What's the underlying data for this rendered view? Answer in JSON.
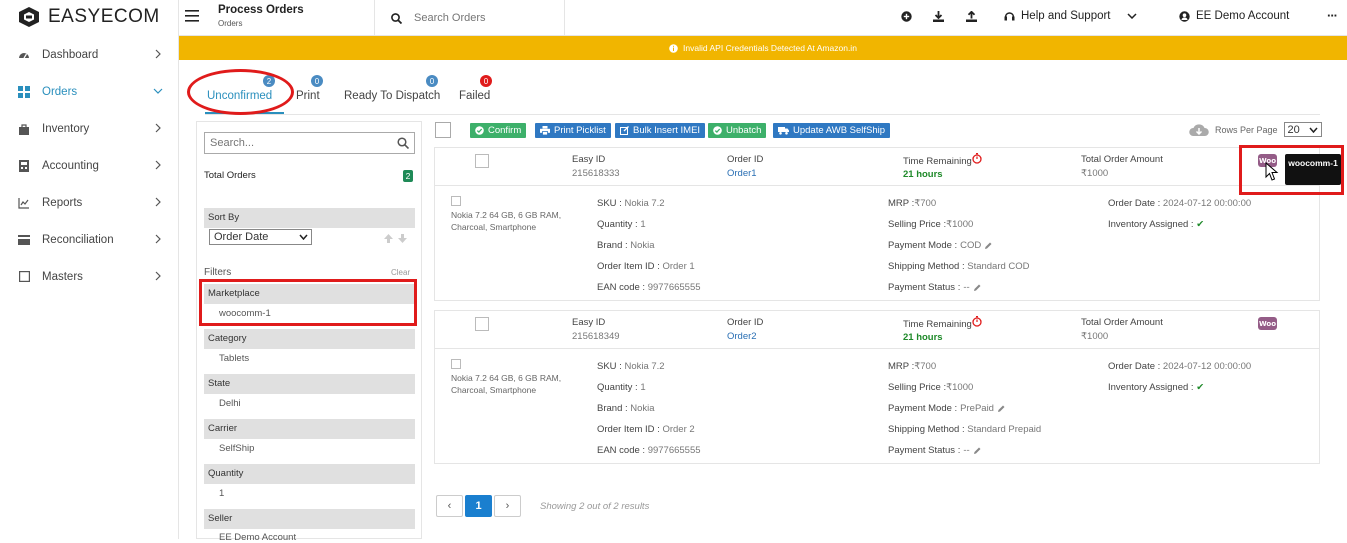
{
  "app": {
    "name": "EASYECOM"
  },
  "sidebar": {
    "items": [
      {
        "label": "Dashboard",
        "icon": "dashboard-icon"
      },
      {
        "label": "Orders",
        "icon": "grid-icon",
        "active": true
      },
      {
        "label": "Inventory",
        "icon": "bag-icon"
      },
      {
        "label": "Accounting",
        "icon": "calculator-icon"
      },
      {
        "label": "Reports",
        "icon": "line-chart-icon"
      },
      {
        "label": "Reconciliation",
        "icon": "card-icon"
      },
      {
        "label": "Masters",
        "icon": "square-icon"
      }
    ]
  },
  "header": {
    "title": "Process Orders",
    "subtitle": "Orders",
    "search_placeholder": "Search Orders",
    "help_label": "Help and Support",
    "account_label": "EE Demo Account",
    "more_label": "···"
  },
  "banner": {
    "text": "Invalid API Credentials Detected At Amazon.in",
    "color": "#f1b500"
  },
  "tabs": [
    {
      "label": "Unconfirmed",
      "count": "2",
      "badge_color": "#4a8bc2",
      "active": true
    },
    {
      "label": "Print",
      "count": "0",
      "badge_color": "#4a8bc2"
    },
    {
      "label": "Ready To Dispatch",
      "count": "0",
      "badge_color": "#4a8bc2"
    },
    {
      "label": "Failed",
      "count": "0",
      "badge_color": "#e01b1b"
    }
  ],
  "filters_panel": {
    "search_placeholder": "Search...",
    "total_label": "Total Orders",
    "total_count": "2",
    "sort_by_label": "Sort By",
    "sort_value": "Order Date",
    "filters_label": "Filters",
    "clear_label": "Clear",
    "sections": [
      {
        "label": "Marketplace",
        "value": "woocomm-1"
      },
      {
        "label": "Category",
        "value": "Tablets"
      },
      {
        "label": "State",
        "value": "Delhi"
      },
      {
        "label": "Carrier",
        "value": "SelfShip"
      },
      {
        "label": "Quantity",
        "value": "1"
      },
      {
        "label": "Seller",
        "value": "EE Demo Account"
      }
    ]
  },
  "actions": {
    "confirm": "Confirm",
    "print_picklist": "Print Picklist",
    "bulk_insert_imei": "Bulk Insert IMEI",
    "unbatch": "Unbatch",
    "update_awb": "Update AWB SelfShip",
    "rows_per_page_label": "Rows Per Page",
    "rows_per_page_value": "20"
  },
  "orders": [
    {
      "easy_id_label": "Easy ID",
      "easy_id": "215618333",
      "order_id_label": "Order ID",
      "order_id": "Order1",
      "time_label": "Time Remaining",
      "time_value": "21 hours",
      "total_label": "Total Order Amount",
      "total_value": "₹1000",
      "product": "Nokia 7.2 64 GB, 6 GB RAM, Charcoal, Smartphone",
      "sku_label": "SKU :",
      "sku": "Nokia 7.2",
      "qty_label": "Quantity :",
      "qty": "1",
      "brand_label": "Brand :",
      "brand": "Nokia",
      "item_label": "Order Item ID :",
      "item_id": "Order 1",
      "ean_label": "EAN code :",
      "ean": "9977665555",
      "mrp_label": "MRP :",
      "mrp": "₹700",
      "sp_label": "Selling Price :",
      "sp": "₹1000",
      "pm_label": "Payment Mode :",
      "pm": "COD",
      "ship_label": "Shipping Method :",
      "ship": "Standard COD",
      "ps_label": "Payment Status :",
      "ps": "--",
      "date_label": "Order Date :",
      "date": "2024-07-12 00:00:00",
      "inv_label": "Inventory Assigned :",
      "inv": "✔"
    },
    {
      "easy_id_label": "Easy ID",
      "easy_id": "215618349",
      "order_id_label": "Order ID",
      "order_id": "Order2",
      "time_label": "Time Remaining",
      "time_value": "21 hours",
      "total_label": "Total Order Amount",
      "total_value": "₹1000",
      "product": "Nokia 7.2 64 GB, 6 GB RAM, Charcoal, Smartphone",
      "sku_label": "SKU :",
      "sku": "Nokia 7.2",
      "qty_label": "Quantity :",
      "qty": "1",
      "brand_label": "Brand :",
      "brand": "Nokia",
      "item_label": "Order Item ID :",
      "item_id": "Order 2",
      "ean_label": "EAN code :",
      "ean": "9977665555",
      "mrp_label": "MRP :",
      "mrp": "₹700",
      "sp_label": "Selling Price :",
      "sp": "₹1000",
      "pm_label": "Payment Mode :",
      "pm": "PrePaid",
      "ship_label": "Shipping Method :",
      "ship": "Standard Prepaid",
      "ps_label": "Payment Status :",
      "ps": "--",
      "date_label": "Order Date :",
      "date": "2024-07-12 00:00:00",
      "inv_label": "Inventory Assigned :",
      "inv": "✔"
    }
  ],
  "tooltip": {
    "text": "woocomm-1"
  },
  "woo_logo": {
    "text": "Woo"
  },
  "pagination": {
    "prev": "‹",
    "page": "1",
    "next": "›",
    "showing": "Showing 2 out of 2 results"
  }
}
